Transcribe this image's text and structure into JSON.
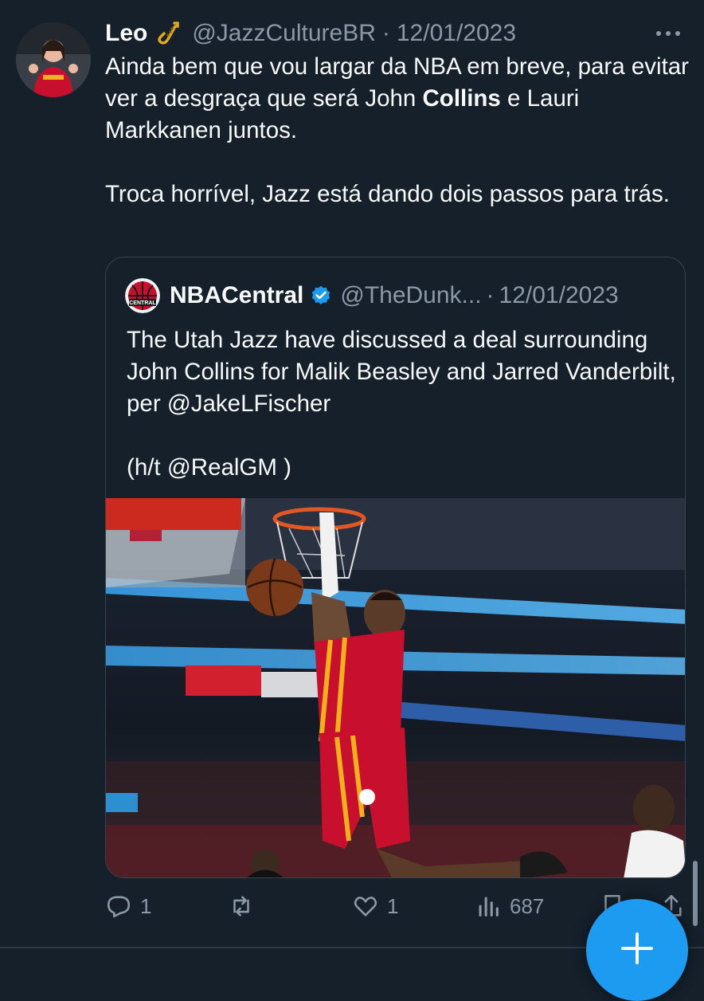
{
  "tweet": {
    "author_name": "Leo",
    "author_emoji_icon": "saxophone-icon",
    "handle": "@JazzCultureBR",
    "separator": "·",
    "date": "12/01/2023",
    "text_line1_a": "Ainda bem que vou largar da NBA em breve, para evitar ver a desgraça que será John ",
    "text_line1_bold": "Collins",
    "text_line1_b": " e Lauri Markkanen juntos.",
    "text_para2": "Troca horrível, Jazz está dando dois passos para trás."
  },
  "quoted": {
    "author_name": "NBACentral",
    "handle": "@TheDunk...",
    "separator": "·",
    "date": "12/01/2023",
    "logo_text": "CENTRAL",
    "text_para1": "The Utah Jazz have discussed a deal surrounding John Collins for Malik Beasley and Jarred Vanderbilt, per @JakeLFischer",
    "text_para2": "(h/t @RealGM )",
    "image_description_icon": "basketball-dunk-photo"
  },
  "actions": {
    "reply_count": "1",
    "retweet_count": "",
    "like_count": "1",
    "views_count": "687"
  },
  "colors": {
    "background": "#15202b",
    "text": "#f7f9f9",
    "muted": "#8b98a5",
    "accent": "#1d9bf0"
  }
}
